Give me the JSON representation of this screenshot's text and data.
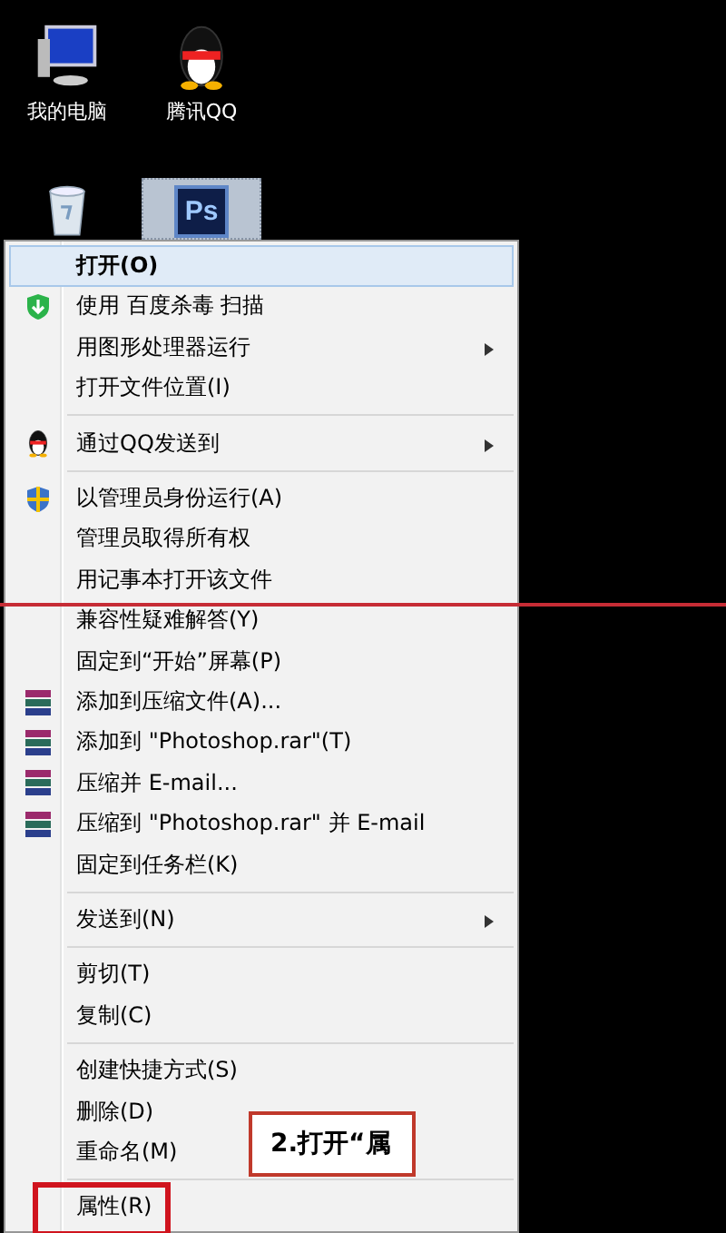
{
  "desktop_icons": [
    [
      {
        "label": "我的电脑",
        "selected": false
      },
      {
        "label": "腾讯QQ",
        "selected": false
      }
    ],
    [
      {
        "selected": false
      },
      {
        "logo_text": "Ps",
        "selected": true
      }
    ]
  ],
  "context_menu": [
    {
      "kind": "item",
      "label": "打开(O)",
      "default": true,
      "selected": true,
      "submenu": false
    },
    {
      "kind": "item",
      "label": "使用 百度杀毒 扫描",
      "selected": false,
      "submenu": false
    },
    {
      "kind": "item",
      "label": "用图形处理器运行",
      "selected": false,
      "submenu": true
    },
    {
      "kind": "item",
      "label": "打开文件位置(I)",
      "selected": false,
      "submenu": false
    },
    {
      "kind": "separator"
    },
    {
      "kind": "item",
      "label": "通过QQ发送到",
      "selected": false,
      "submenu": true
    },
    {
      "kind": "separator"
    },
    {
      "kind": "item",
      "label": "以管理员身份运行(A)",
      "selected": false,
      "submenu": false
    },
    {
      "kind": "item",
      "label": "管理员取得所有权",
      "selected": false,
      "submenu": false
    },
    {
      "kind": "item",
      "label": "用记事本打开该文件",
      "selected": false,
      "submenu": false
    },
    {
      "kind": "item",
      "label": "兼容性疑难解答(Y)",
      "selected": false,
      "submenu": false
    },
    {
      "kind": "item",
      "label": "固定到“开始”屏幕(P)",
      "selected": false,
      "submenu": false
    },
    {
      "kind": "item",
      "label": "添加到压缩文件(A)...",
      "selected": false,
      "submenu": false
    },
    {
      "kind": "item",
      "label": "添加到 \"Photoshop.rar\"(T)",
      "selected": false,
      "submenu": false
    },
    {
      "kind": "item",
      "label": "压缩并 E-mail...",
      "selected": false,
      "submenu": false
    },
    {
      "kind": "item",
      "label": "压缩到 \"Photoshop.rar\" 并 E-mail",
      "selected": false,
      "submenu": false
    },
    {
      "kind": "item",
      "label": "固定到任务栏(K)",
      "selected": false,
      "submenu": false
    },
    {
      "kind": "separator"
    },
    {
      "kind": "item",
      "label": "发送到(N)",
      "selected": false,
      "submenu": true
    },
    {
      "kind": "separator"
    },
    {
      "kind": "item",
      "label": "剪切(T)",
      "selected": false,
      "submenu": false
    },
    {
      "kind": "item",
      "label": "复制(C)",
      "selected": false,
      "submenu": false
    },
    {
      "kind": "separator"
    },
    {
      "kind": "item",
      "label": "创建快捷方式(S)",
      "selected": false,
      "submenu": false
    },
    {
      "kind": "item",
      "label": "删除(D)",
      "selected": false,
      "submenu": false
    },
    {
      "kind": "item",
      "label": "重命名(M)",
      "selected": false,
      "submenu": false
    },
    {
      "kind": "separator"
    },
    {
      "kind": "item",
      "label": "属性(R)",
      "selected": false,
      "submenu": false,
      "boxed": true
    }
  ],
  "annotations": {
    "callout": "2.打开“属"
  }
}
